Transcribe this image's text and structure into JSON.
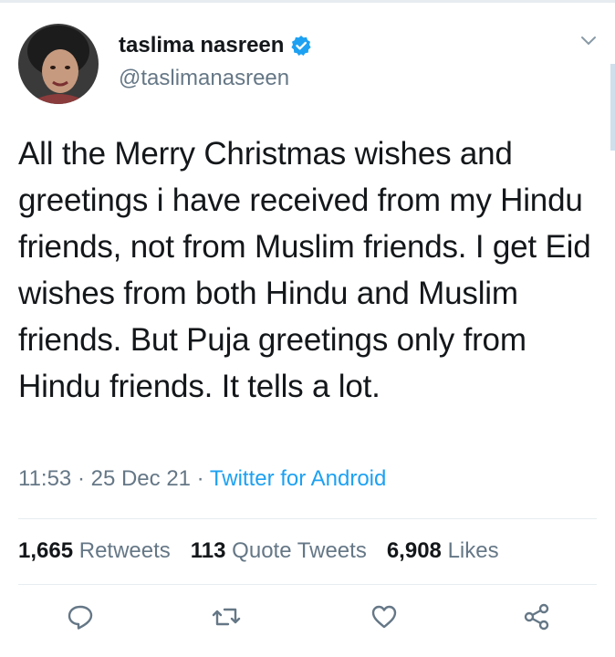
{
  "tweet": {
    "author": {
      "display_name": "taslima nasreen",
      "handle": "@taslimanasreen",
      "verified": true
    },
    "text": "All the Merry Christmas wishes and greetings i have received from my Hindu friends, not from Muslim friends. I get Eid wishes from both Hindu and Muslim friends. But Puja greetings only from Hindu friends. It tells a lot.",
    "time": "11:53",
    "date": "25 Dec 21",
    "separator": " · ",
    "source": "Twitter for Android",
    "stats": {
      "retweets_count": "1,665",
      "retweets_label": "Retweets",
      "quotes_count": "113",
      "quotes_label": "Quote Tweets",
      "likes_count": "6,908",
      "likes_label": "Likes"
    }
  },
  "icons": {
    "verified": "verified-badge-icon",
    "menu": "chevron-down-icon",
    "reply": "reply-icon",
    "retweet": "retweet-icon",
    "like": "heart-icon",
    "share": "share-icon"
  },
  "colors": {
    "accent": "#1da1f2",
    "text": "#14171a",
    "secondary": "#657786",
    "divider": "#e6ecf0"
  }
}
